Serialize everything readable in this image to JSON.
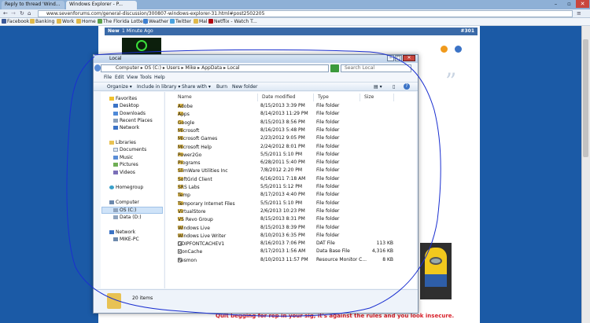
{
  "browser": {
    "tabs": [
      {
        "label": "Reply to thread 'Wind..."
      },
      {
        "label": "Windows Explorer - P..."
      }
    ],
    "url": "www.sevenforums.com/general-discussion/300807-windows-explorer-31.html#post2502205",
    "bookmarks": [
      "Facebook",
      "Banking",
      "Work",
      "Home",
      "The Florida Lottery",
      "Weather",
      "Twitter",
      "Mal",
      "Netflix - Watch T..."
    ]
  },
  "forum": {
    "post_badge": "New",
    "post_time": "1 Minute Ago",
    "post_number": "#301",
    "signature": "Quit begging for rep in your sig, it's against the rules and you look insecure."
  },
  "explorer": {
    "title": "Local",
    "breadcrumb": [
      "Computer",
      "OS (C:)",
      "Users",
      "Mike",
      "AppData",
      "Local"
    ],
    "search_placeholder": "Search Local",
    "menu": [
      "File",
      "Edit",
      "View",
      "Tools",
      "Help"
    ],
    "commands": [
      "Organize",
      "Include in library",
      "Share with",
      "Burn",
      "New folder"
    ],
    "columns": [
      "Name",
      "Date modified",
      "Type",
      "Size"
    ],
    "nav": {
      "favorites_header": "Favorites",
      "favorites": [
        "Desktop",
        "Downloads",
        "Recent Places",
        "Network"
      ],
      "libraries_header": "Libraries",
      "libraries": [
        "Documents",
        "Music",
        "Pictures",
        "Videos"
      ],
      "homegroup": "Homegroup",
      "computer_header": "Computer",
      "drives": [
        "OS (C:)",
        "Data (D:)"
      ],
      "network_header": "Network",
      "network_items": [
        "MIKE-PC"
      ]
    },
    "rows": [
      {
        "name": "Adobe",
        "date": "8/15/2013 3:39 PM",
        "type": "File folder",
        "size": "",
        "kind": "folder"
      },
      {
        "name": "Apps",
        "date": "8/14/2013 11:29 PM",
        "type": "File folder",
        "size": "",
        "kind": "folder"
      },
      {
        "name": "Google",
        "date": "8/15/2013 8:56 PM",
        "type": "File folder",
        "size": "",
        "kind": "folder"
      },
      {
        "name": "Microsoft",
        "date": "8/16/2013 5:48 PM",
        "type": "File folder",
        "size": "",
        "kind": "folder"
      },
      {
        "name": "Microsoft Games",
        "date": "2/23/2012 9:05 PM",
        "type": "File folder",
        "size": "",
        "kind": "folder"
      },
      {
        "name": "Microsoft Help",
        "date": "2/24/2012 8:01 PM",
        "type": "File folder",
        "size": "",
        "kind": "folder"
      },
      {
        "name": "Power2Go",
        "date": "5/5/2011 5:10 PM",
        "type": "File folder",
        "size": "",
        "kind": "folder"
      },
      {
        "name": "Programs",
        "date": "6/28/2011 5:40 PM",
        "type": "File folder",
        "size": "",
        "kind": "folder"
      },
      {
        "name": "SlimWare Utilities Inc",
        "date": "7/8/2012 2:20 PM",
        "type": "File folder",
        "size": "",
        "kind": "folder"
      },
      {
        "name": "SoftGrid Client",
        "date": "6/16/2011 7:18 AM",
        "type": "File folder",
        "size": "",
        "kind": "folder"
      },
      {
        "name": "SRS Labs",
        "date": "5/5/2011 5:12 PM",
        "type": "File folder",
        "size": "",
        "kind": "folder"
      },
      {
        "name": "Temp",
        "date": "8/17/2013 4:40 PM",
        "type": "File folder",
        "size": "",
        "kind": "folder"
      },
      {
        "name": "Temporary Internet Files",
        "date": "5/5/2011 5:10 PM",
        "type": "File folder",
        "size": "",
        "kind": "folder"
      },
      {
        "name": "VirtualStore",
        "date": "2/6/2013 10:23 PM",
        "type": "File folder",
        "size": "",
        "kind": "folder"
      },
      {
        "name": "VS Revo Group",
        "date": "8/15/2013 8:31 PM",
        "type": "File folder",
        "size": "",
        "kind": "folder"
      },
      {
        "name": "Windows Live",
        "date": "8/15/2013 8:39 PM",
        "type": "File folder",
        "size": "",
        "kind": "folder"
      },
      {
        "name": "Windows Live Writer",
        "date": "8/10/2013 6:35 PM",
        "type": "File folder",
        "size": "",
        "kind": "folder"
      },
      {
        "name": "GDIPFONTCACHEV1",
        "date": "8/16/2013 7:06 PM",
        "type": "DAT File",
        "size": "113 KB",
        "kind": "file"
      },
      {
        "name": "IconCache",
        "date": "8/17/2013 1:56 AM",
        "type": "Data Base File",
        "size": "4,316 KB",
        "kind": "file"
      },
      {
        "name": "Resmon",
        "date": "8/10/2013 11:57 PM",
        "type": "Resource Monitor C...",
        "size": "8 KB",
        "kind": "file"
      }
    ],
    "status": "20 items"
  },
  "colors": {
    "chrome": "#8eb0d6",
    "folder": "#e8c254",
    "signature": "#d8202a",
    "annotation": "#1a2fd0"
  }
}
